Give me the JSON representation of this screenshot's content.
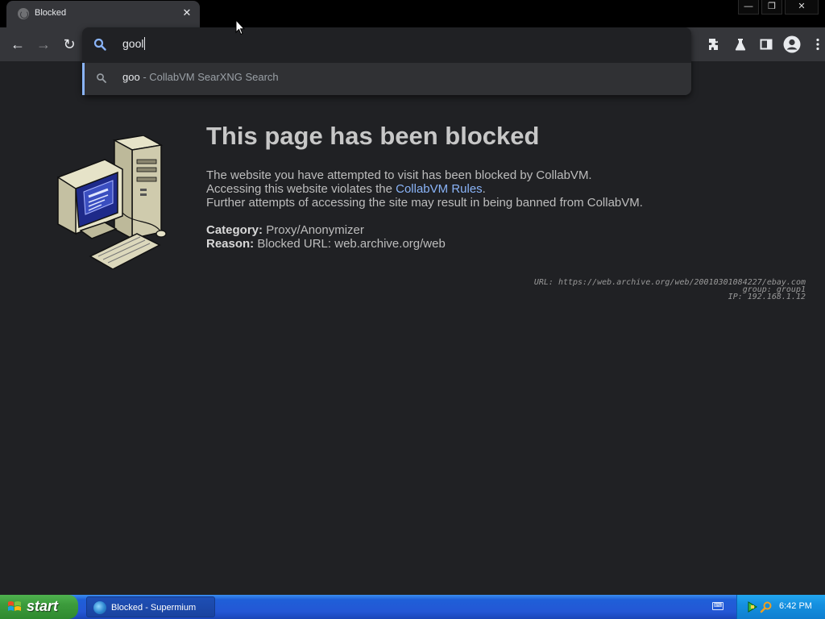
{
  "tab": {
    "title": "Blocked",
    "close_glyph": "✕"
  },
  "window": {
    "minimize_glyph": "—",
    "restore_glyph": "❐",
    "close_glyph": "✕"
  },
  "toolbar": {
    "back_glyph": "←",
    "forward_glyph": "→",
    "reload_glyph": "↻"
  },
  "omnibox": {
    "typed_text": "goo",
    "typed_completion": "l",
    "suggestion": {
      "query": "goo",
      "separator": " - ",
      "engine": "CollabVM SearXNG Search"
    }
  },
  "page": {
    "heading": "This page has been blocked",
    "line1": "The website you have attempted to visit has been blocked by CollabVM.",
    "line2_prefix": "Accessing this website violates the ",
    "line2_link": "CollabVM Rules",
    "line2_suffix": ".",
    "line3": "Further attempts of accessing the site may result in being banned from CollabVM.",
    "category_label": "Category:",
    "category_value": "Proxy/Anonymizer",
    "reason_label": "Reason:",
    "reason_value": "Blocked URL: web.archive.org/web",
    "meta_url": "URL: https://web.archive.org/web/20010301084227/ebay.com",
    "meta_group": "group: group1",
    "meta_ip": "IP: 192.168.1.12"
  },
  "taskbar": {
    "start_label": "start",
    "task_label": "Blocked - Supermium",
    "keyboard_label": "⌨",
    "clock": "6:42 PM"
  },
  "colors": {
    "link": "#8ab4f8",
    "omnibox_accent": "#8ab4f8",
    "page_bg": "#202124",
    "taskbar_blue": "#2457d5",
    "start_green": "#3c9b3c"
  },
  "icons": [
    "globe-icon",
    "search-icon",
    "extensions-icon",
    "flask-icon",
    "side-panel-icon",
    "profile-icon",
    "menu-icon",
    "windows-flag-icon",
    "keyboard-icon",
    "network-icon",
    "search-tray-icon",
    "cursor-icon"
  ]
}
